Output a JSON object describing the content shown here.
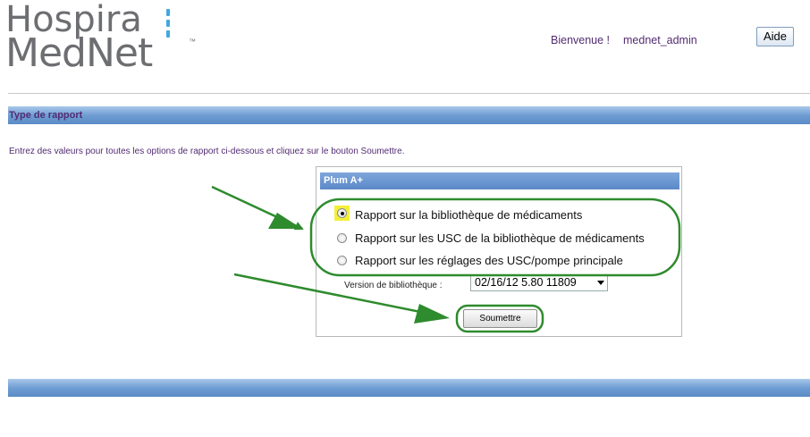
{
  "header": {
    "logo_line1": "Hospira",
    "logo_line2": "MedNet",
    "logo_tm": "™",
    "welcome_label": "Bienvenue !",
    "username": "mednet_admin",
    "help_label": "Aide"
  },
  "section": {
    "title": "Type de rapport",
    "instructions": "Entrez des valeurs pour toutes les options de rapport ci-dessous et cliquez sur le bouton Soumettre."
  },
  "panel": {
    "title": "Plum A+",
    "options": [
      {
        "label": "Rapport sur la bibliothèque de médicaments",
        "selected": true
      },
      {
        "label": "Rapport sur les USC de la bibliothèque de médicaments",
        "selected": false
      },
      {
        "label": "Rapport sur les réglages des USC/pompe principale",
        "selected": false
      }
    ],
    "version_label": "Version de bibliothèque :",
    "version_value": "02/16/12 5.80 11809",
    "submit_label": "Soumettre"
  },
  "colors": {
    "accent_text": "#522b72",
    "bar_blue": "#6f9dd3",
    "annotation_green": "#2e8b2e",
    "highlight_yellow": "#f5ef3a"
  },
  "icons": {
    "select_arrow": "chevron-down-icon",
    "radio": "radio-button-icon",
    "annotation_arrow": "arrow-icon"
  }
}
